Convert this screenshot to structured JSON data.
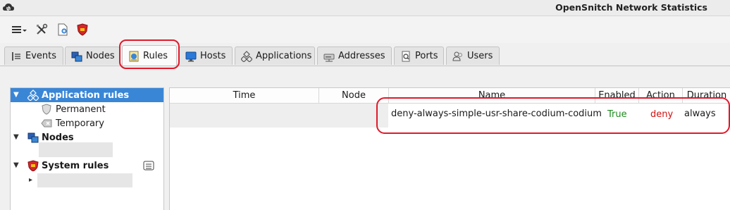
{
  "window": {
    "title": "OpenSnitch Network Statistics"
  },
  "toolbar": {
    "buttons": [
      {
        "name": "menu",
        "icon": "hamburger-menu-icon"
      },
      {
        "name": "preferences",
        "icon": "tools-icon"
      },
      {
        "name": "new-rule",
        "icon": "new-document-icon"
      },
      {
        "name": "firewall",
        "icon": "firewall-shield-icon"
      }
    ]
  },
  "tabs": [
    {
      "label": "Events",
      "icon": "events-icon"
    },
    {
      "label": "Nodes",
      "icon": "nodes-icon"
    },
    {
      "label": "Rules",
      "icon": "rules-icon",
      "active": true
    },
    {
      "label": "Hosts",
      "icon": "monitor-icon"
    },
    {
      "label": "Applications",
      "icon": "applications-icon"
    },
    {
      "label": "Addresses",
      "icon": "network-drive-icon"
    },
    {
      "label": "Ports",
      "icon": "ports-icon"
    },
    {
      "label": "Users",
      "icon": "users-icon"
    }
  ],
  "tree": {
    "application_rules": "Application rules",
    "permanent": "Permanent",
    "temporary": "Temporary",
    "nodes": "Nodes",
    "system_rules": "System rules"
  },
  "table": {
    "columns": [
      "Time",
      "Node",
      "Name",
      "Enabled",
      "Action",
      "Duration"
    ],
    "rows": [
      {
        "time": "",
        "node": "",
        "name": "deny-always-simple-usr-share-codium-codium",
        "enabled": "True",
        "action": "deny",
        "duration": "always"
      }
    ]
  },
  "colors": {
    "selection": "#3a86d6",
    "enabled_true": "#1f8a1f",
    "action_deny": "#d01010",
    "highlight": "#e0192b"
  }
}
